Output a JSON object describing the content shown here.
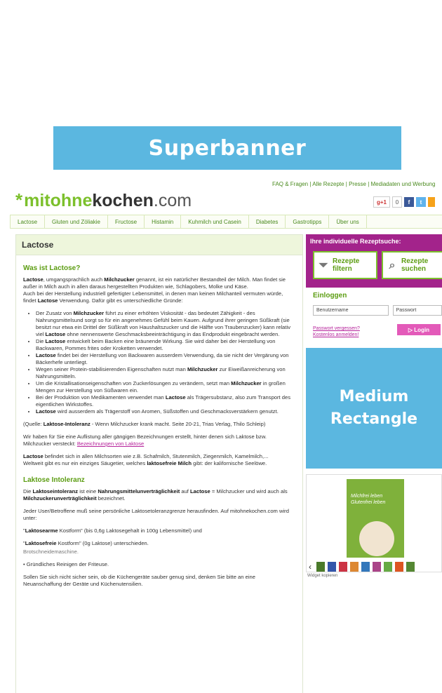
{
  "banner": {
    "label": "Superbanner"
  },
  "header": {
    "top_links": "FAQ & Fragen | Alle Rezepte | Presse | Mediadaten und Werbung",
    "logo": {
      "mit": "mit",
      "ohne": "ohne",
      "kochen": "kochen",
      "com": ".com"
    },
    "social": {
      "gplus": "g+1",
      "gcount": "0",
      "fb": "f",
      "tw": "t",
      "rss": ""
    }
  },
  "nav": {
    "items": [
      "Lactose",
      "Gluten und Zöliakie",
      "Fructose",
      "Histamin",
      "Kuhmilch und Casein",
      "Diabetes",
      "Gastrotipps",
      "Über uns"
    ]
  },
  "main": {
    "page_title": "Lactose",
    "h1": "Was ist Lactose?",
    "intro": [
      "Lactose",
      ", umgangsprachlich auch ",
      "Milchzucker",
      " genannt, ist ein natürlicher Bestandteil der Milch. Man findet sie außer in Milch auch in allen daraus hergestellten Produkten wie, Schlagobers, Molke und Käse.",
      "Auch bei der Herstellung industriell gefertigter Lebensmittel, in denen man keinen Milchanteil vermuten würde, findet ",
      "Lactose",
      " Verwendung. Dafür gibt es unterschiedliche Gründe:"
    ],
    "bullets": [
      [
        "Der Zusatz von ",
        "Milchzucker",
        " führt zu einer erhöhten Viskosität - das bedeutet Zähigkeit - des Nahrungsmittelsund sorgt so für ein angenehmes Gefühl beim Kauen. Aufgrund ihrer geringen Süßkraft (sie besitzt nur etwa ein Drittel der Süßkraft von Haushaltszucker und die Hälfte von Traubenzucker) kann relativ viel ",
        "Lactose",
        " ohne nennenswerte Geschmacksbeeinträchtigung in das Endprodukt eingebracht werden."
      ],
      [
        "Die ",
        "Lactose",
        " entwickelt beim Backen eine bräunende Wirkung. Sie wird daher bei der Herstellung von Backwaren, Pommes frites oder Kroketten verwendet.",
        "",
        ""
      ],
      [
        "",
        "Lactose",
        " findet bei der Herstellung von Backwaren ausserdem Verwendung, da sie nicht der Vergärung von Bäckerhefe unterliegt.",
        "",
        ""
      ],
      [
        "Wegen seiner Protein-stabilisierenden Eigenschaften nutzt man ",
        "Milchzucker",
        " zur Eiweißanreicherung von Nahrungsmitteln.",
        "",
        ""
      ],
      [
        "Um die Kristallisationseigenschaften von Zuckerlösungen zu verändern, setzt man ",
        "Milchzucker",
        " in großen Mengen zur Herstellung von Süßwaren ein.",
        "",
        ""
      ],
      [
        "Bei der Produktion von Medikamenten verwendet man ",
        "Lactose",
        " als Trägersubstanz, also zum Transport des eigentlichen Wirkstoffes.",
        "",
        ""
      ],
      [
        "",
        "Lactose",
        " wird ausserdem als Trägerstoff von Aromen, Süßstoffen und Geschmacksverstärkern genutzt.",
        "",
        ""
      ]
    ],
    "source": [
      "(Quelle: ",
      "Laktose-Intoleranz",
      " - Wenn Milchzucker krank macht. Seite 20-21, Trias Verlag, Thilo Schleip)"
    ],
    "list_text": "Wir haben für Sie eine Auflistung aller gängigen Bezeichnungen erstellt, hinter denen sich Laktose bzw. Milchzucker versteckt: ",
    "list_link": "Bezeichnungen von Laktose",
    "milk": [
      "Lactose",
      " befindet sich in allen Milchsorten wie z.B. Schafmilch, Stutenmilch, Ziegenmilch, Kamelmilch,...",
      "Weltweit gibt es nur ein einziges Säugetier, welches ",
      "laktosefreie Milch",
      " gibt: der kalifornische Seelöwe."
    ],
    "h2": "Laktose Intoleranz",
    "intol": [
      "Die ",
      "Laktoseintoleranz",
      " ist eine ",
      "Nahrungsmittelunverträglichkeit",
      " auf ",
      "Lactose",
      " = Milchzucker und wird auch als ",
      "Milchzuckerunverträglichkeit",
      " bezeichnet."
    ],
    "limit": "Jeder User/Betroffene muß seine persönliche Laktosetoleranzgrenze herausfinden. Auf mitohnekochen.com wird unter:",
    "arm": [
      "\"",
      "Laktosearme",
      " Kostform\" (bis 0,6g Laktosegehalt in 100g Lebensmittel) und"
    ],
    "frei": [
      "\"",
      "Laktosefreie",
      " Kostform\" (0g Laktose) unterschieden."
    ],
    "cut": "Brotschneidemaschine.",
    "fritteuse": "• Gründliches Reinigen der Friteuse.",
    "final": "Sollen Sie sich nicht sicher sein, ob die Küchengeräte sauber genug sind, denken Sie bitte an eine Neuanschaffung der Geräte und Küchenutensilien."
  },
  "sidebar": {
    "search_title": "Ihre individuelle Rezeptsuche:",
    "filter_btn": [
      "Rezepte",
      "filtern"
    ],
    "search_btn": [
      "Rezepte",
      "suchen"
    ],
    "login_title": "Einloggen",
    "user_placeholder": "Benutzername",
    "pass_placeholder": "Passwort",
    "forgot": "Passwort vergessen?",
    "register": "Kostenlos anmelden!",
    "login_btn": "▷ Login",
    "medrect": [
      "Medium",
      "Rectangle"
    ],
    "book_title": "Milchfrei leben Glutenfrei leben",
    "widget_label": "Widget kopieren"
  },
  "colors": {
    "accent_green": "#7cc02c",
    "magenta": "#a3238b",
    "banner_blue": "#5bb7e0",
    "link": "#b6239b"
  }
}
